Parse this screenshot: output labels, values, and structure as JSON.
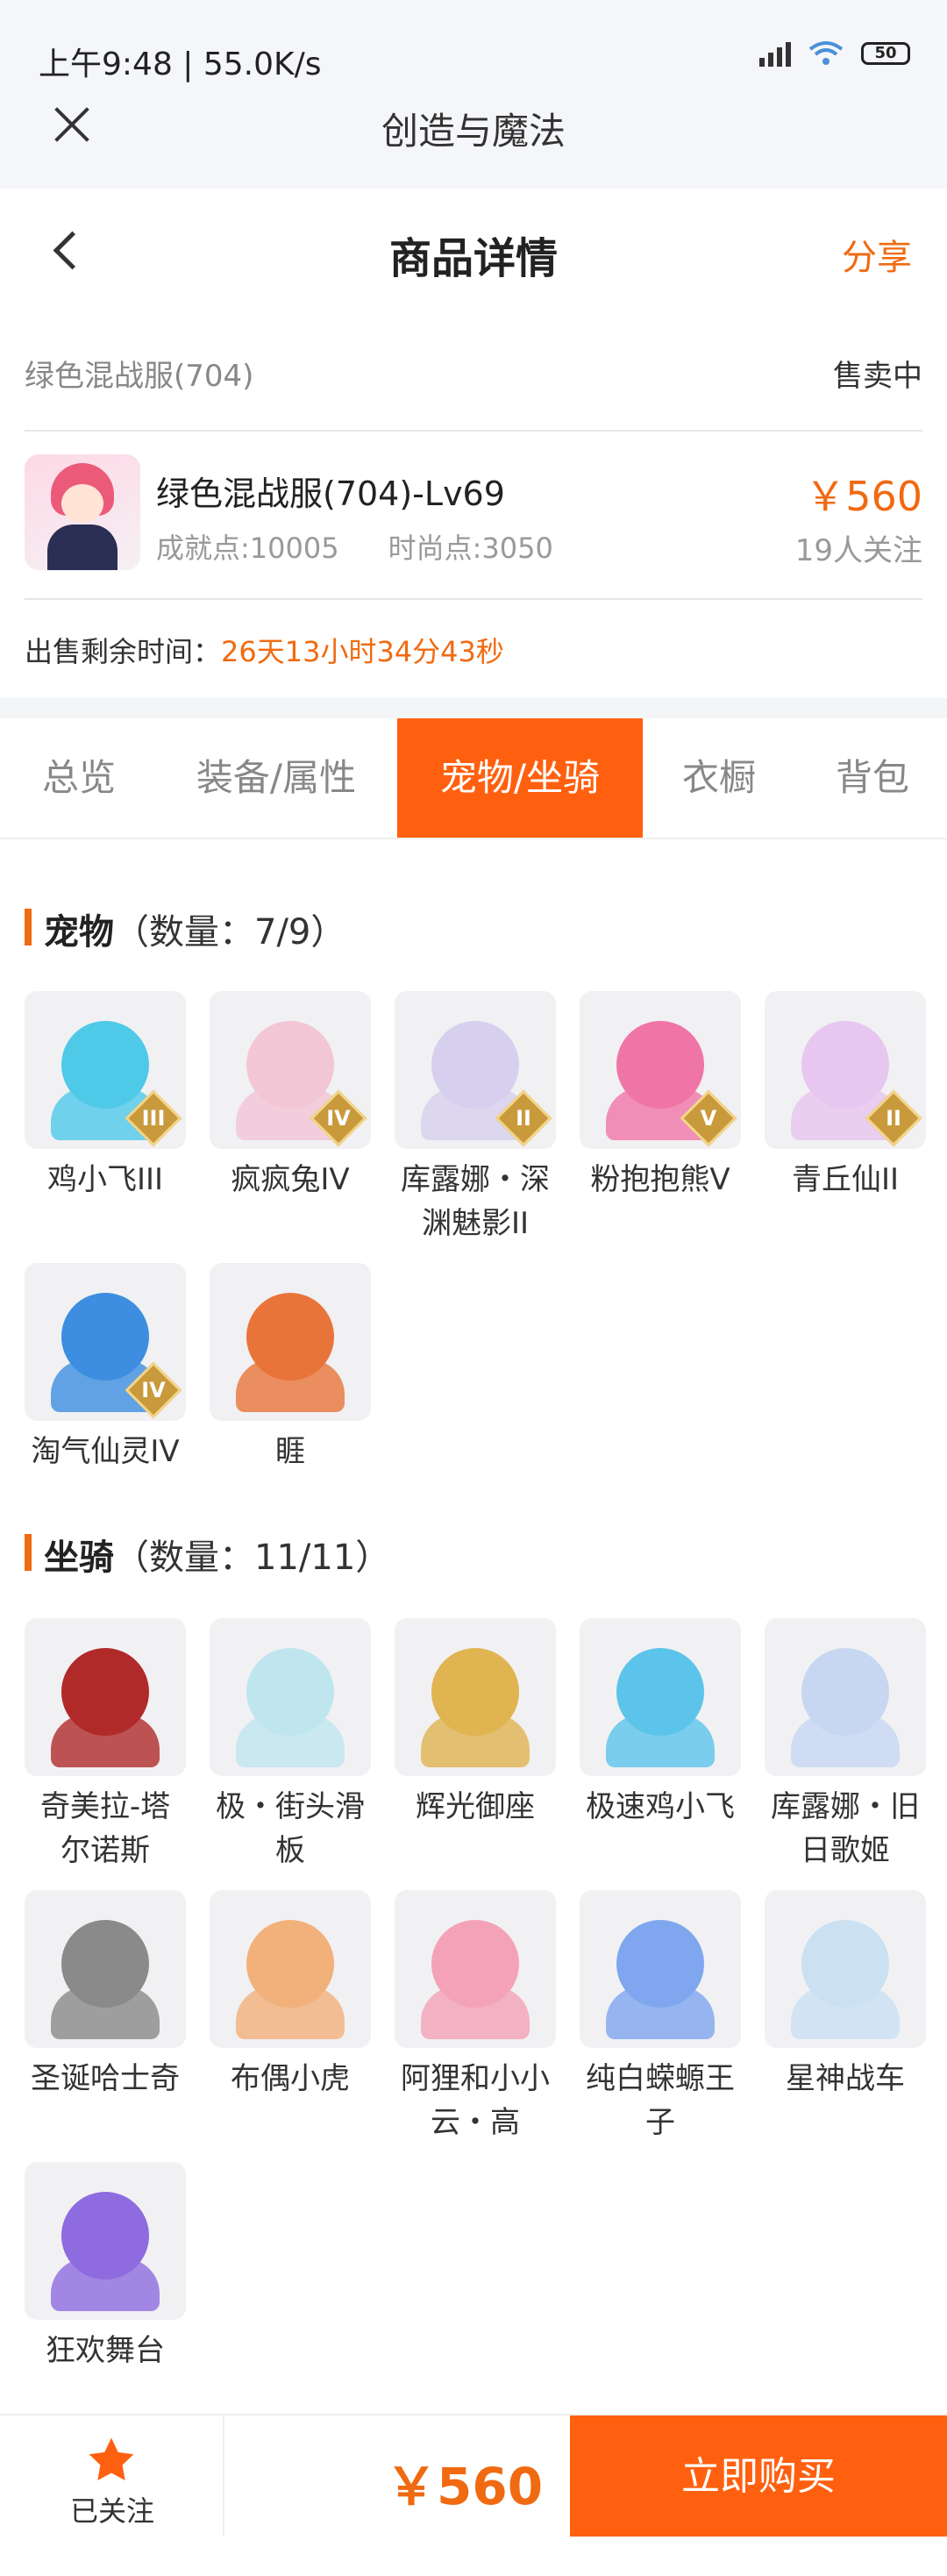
{
  "status": {
    "time": "上午9:48 | 55.0K/s",
    "battery": "50"
  },
  "app": {
    "title": "创造与魔法"
  },
  "nav": {
    "title": "商品详情",
    "share": "分享"
  },
  "listing": {
    "name": "绿色混战服(704)",
    "status": "售卖中"
  },
  "item": {
    "title": "绿色混战服(704)-Lv69",
    "achievement": "成就点:10005",
    "fashion": "时尚点:3050",
    "price": "￥560",
    "followers": "19人关注"
  },
  "remaining": {
    "label": "出售剩余时间：",
    "value": "26天13小时34分43秒"
  },
  "tabs": [
    "总览",
    "装备/属性",
    "宠物/坐骑",
    "衣橱",
    "背包"
  ],
  "active_tab": 2,
  "pets": {
    "title": "宠物",
    "count": "（数量：7/9）",
    "items": [
      {
        "name": "鸡小飞III",
        "badge": "III",
        "color": "#4fc9e8"
      },
      {
        "name": "疯疯兔IV",
        "badge": "IV",
        "color": "#f3c6d6"
      },
      {
        "name": "库露娜・深\n渊魅影II",
        "badge": "II",
        "color": "#d7cfee"
      },
      {
        "name": "粉抱抱熊Ⅴ",
        "badge": "V",
        "color": "#f075a7"
      },
      {
        "name": "青丘仙II",
        "badge": "II",
        "color": "#e7c6ef"
      },
      {
        "name": "淘气仙灵IV",
        "badge": "IV",
        "color": "#3d8ee0"
      },
      {
        "name": "睚",
        "badge": "",
        "color": "#e9743a"
      }
    ]
  },
  "mounts": {
    "title": "坐骑",
    "count": "（数量：11/11）",
    "items": [
      {
        "name": "奇美拉-塔\n尔诺斯",
        "color": "#b02a2a"
      },
      {
        "name": "极・街头滑\n板",
        "color": "#bfe6ef"
      },
      {
        "name": "辉光御座",
        "color": "#e0b450"
      },
      {
        "name": "极速鸡小飞",
        "color": "#5cc4ea"
      },
      {
        "name": "库露娜・旧\n日歌姬",
        "color": "#c7d7f2"
      },
      {
        "name": "圣诞哈士奇",
        "color": "#8a8a8a"
      },
      {
        "name": "布偶小虎",
        "color": "#f2b07a"
      },
      {
        "name": "阿狸和小小\n云・高",
        "color": "#f4a2b8"
      },
      {
        "name": "纯白蝾螈王\n子",
        "color": "#7fa6ef"
      },
      {
        "name": "星神战车",
        "color": "#cbe1f2"
      },
      {
        "name": "狂欢舞台",
        "color": "#8f6be0"
      }
    ]
  },
  "footer": {
    "follow": "已关注",
    "price": "￥560",
    "buy": "立即购买"
  }
}
